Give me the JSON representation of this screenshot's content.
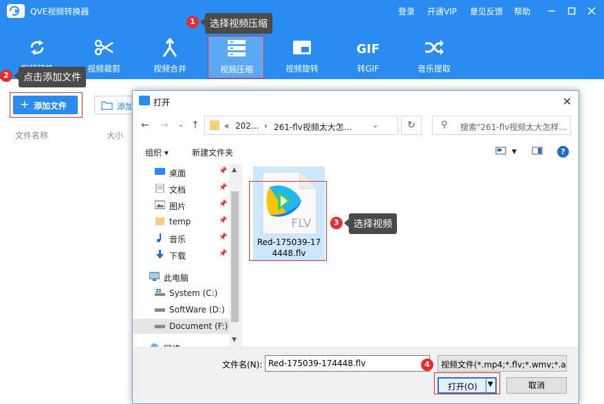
{
  "app": {
    "title": "QVE视频转换器",
    "links": [
      "登录",
      "开通VIP",
      "意见反馈",
      "帮助"
    ]
  },
  "toolbar": [
    {
      "label": "视频转换",
      "icon": "refresh-icon"
    },
    {
      "label": "视频裁剪",
      "icon": "scissors-icon"
    },
    {
      "label": "视频合并",
      "icon": "merge-icon"
    },
    {
      "label": "视频压缩",
      "icon": "compress-icon"
    },
    {
      "label": "视频旋转",
      "icon": "rotate-icon"
    },
    {
      "label": "转GIF",
      "icon": "gif-icon",
      "icon_text": "GIF"
    },
    {
      "label": "音乐提取",
      "icon": "shuffle-icon"
    }
  ],
  "callouts": [
    {
      "num": "1",
      "text": "选择视频压缩"
    },
    {
      "num": "2",
      "text": "点击添加文件"
    },
    {
      "num": "3",
      "text": "选择视频"
    },
    {
      "num": "4"
    }
  ],
  "left": {
    "add_file": "添加文件",
    "add_folder": "添加",
    "columns": [
      "文件名称",
      "大小"
    ]
  },
  "dialog": {
    "title": "打开",
    "address": [
      "«",
      "202...",
      "›",
      "261-flv视频太大怎..."
    ],
    "search_placeholder": "搜索\"261-flv视频太大怎样...",
    "organize": "组织 ▾",
    "new_folder": "新建文件夹",
    "nav": [
      {
        "label": "桌面",
        "pinned": true,
        "icon": "desktop-icon"
      },
      {
        "label": "文档",
        "pinned": true,
        "icon": "document-icon"
      },
      {
        "label": "图片",
        "pinned": true,
        "icon": "picture-icon"
      },
      {
        "label": "temp",
        "pinned": true,
        "icon": "folder-icon"
      },
      {
        "label": "音乐",
        "pinned": true,
        "icon": "music-icon"
      },
      {
        "label": "下载",
        "pinned": true,
        "icon": "download-icon"
      },
      {
        "label": "此电脑",
        "pinned": false,
        "icon": "computer-icon"
      },
      {
        "label": "System (C:)",
        "pinned": false,
        "icon": "drive-icon"
      },
      {
        "label": "SoftWare (D:)",
        "pinned": false,
        "icon": "drive-icon"
      },
      {
        "label": "Document (F:)",
        "pinned": false,
        "icon": "drive-icon",
        "selected": true
      },
      {
        "label": "网络",
        "pinned": false,
        "icon": "network-icon"
      }
    ],
    "file": {
      "name_line1": "Red-175039-17",
      "name_line2": "4448.flv",
      "ext_label": "FLV"
    },
    "filename_label": "文件名(N):",
    "filename_value": "Red-175039-174448.flv",
    "filetype": "视频文件(*.mp4;*.flv;*.wmv;*.a",
    "open": "打开(O)",
    "cancel": "取消"
  },
  "colors": {
    "brand": "#2a8cf0",
    "highlight": "#e52e2e",
    "callout": "#4a4a4a"
  }
}
